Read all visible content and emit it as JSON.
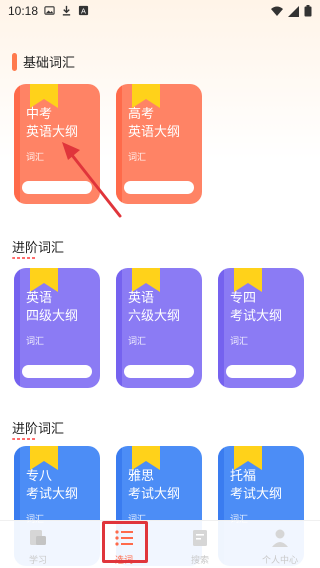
{
  "status_bar": {
    "time": "10:18",
    "icons": [
      "image-icon",
      "download-icon",
      "a-box-icon"
    ],
    "right_icons": [
      "wifi-icon",
      "signal-icon",
      "battery-icon"
    ]
  },
  "sections": [
    {
      "title": "基础词汇",
      "books": [
        {
          "line1": "中考",
          "line2": "英语大纲",
          "sub": "词汇",
          "color": "#ff8365"
        },
        {
          "line1": "高考",
          "line2": "英语大纲",
          "sub": "词汇",
          "color": "#ff8365"
        }
      ]
    },
    {
      "title": "进阶词汇",
      "books": [
        {
          "line1": "英语",
          "line2": "四级大纲",
          "sub": "词汇",
          "color": "#8b7bf4"
        },
        {
          "line1": "英语",
          "line2": "六级大纲",
          "sub": "词汇",
          "color": "#8b7bf4"
        },
        {
          "line1": "专四",
          "line2": "考试大纲",
          "sub": "词汇",
          "color": "#8b7bf4"
        }
      ]
    },
    {
      "title": "进阶词汇",
      "books": [
        {
          "line1": "专八",
          "line2": "考试大纲",
          "sub": "词汇",
          "color": "#4c8df6"
        },
        {
          "line1": "雅思",
          "line2": "考试大纲",
          "sub": "词汇",
          "color": "#4c8df6"
        },
        {
          "line1": "托福",
          "line2": "考试大纲",
          "sub": "词汇",
          "color": "#4c8df6"
        }
      ]
    }
  ],
  "tabs": [
    {
      "label": "学习",
      "icon": "study-icon",
      "active": false
    },
    {
      "label": "选词",
      "icon": "list-icon",
      "active": true
    },
    {
      "label": "搜索",
      "icon": "book-icon",
      "active": false
    },
    {
      "label": "个人中心",
      "icon": "user-icon",
      "active": false
    }
  ],
  "colors": {
    "accent": "#ff6a4a",
    "ribbon": "#ffd21a",
    "annotation_red": "#e0353b"
  }
}
